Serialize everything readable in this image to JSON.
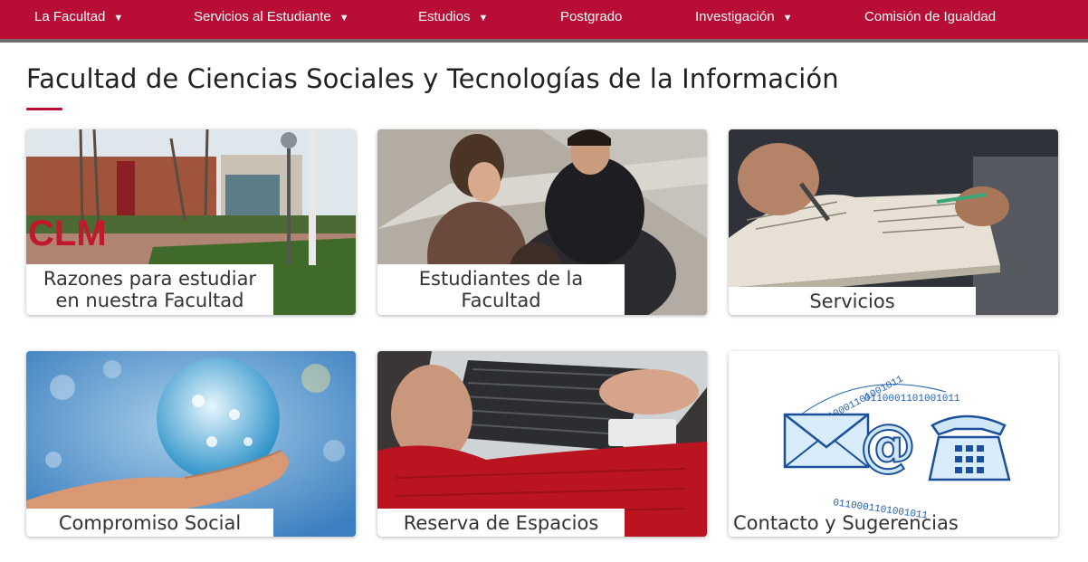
{
  "nav": {
    "items": [
      {
        "label": "La Facultad",
        "caret": "▼"
      },
      {
        "label": "Servicios al Estudiante",
        "caret": "▼"
      },
      {
        "label": "Estudios",
        "caret": "▼"
      },
      {
        "label": "Postgrado",
        "caret": ""
      },
      {
        "label": "Investigación",
        "caret": "▼"
      },
      {
        "label": "Comisión de Igualdad",
        "caret": ""
      }
    ]
  },
  "page": {
    "title": "Facultad de Ciencias Sociales y Tecnologías de la Información"
  },
  "cards": [
    {
      "line1": "Razones para estudiar",
      "line2": "en nuestra Facultad"
    },
    {
      "line1": "Estudiantes de la",
      "line2": "Facultad"
    },
    {
      "label": "Servicios"
    },
    {
      "label": "Compromiso Social"
    },
    {
      "label": "Reserva de Espacios"
    },
    {
      "label": "Contacto y Sugerencias"
    }
  ],
  "images": {
    "sign_text": "CLM",
    "binary_text": "0110001101001011",
    "at_symbol": "@"
  },
  "colors": {
    "brand": "#b80d34",
    "nav_border": "#6c6c6c",
    "title_text": "#222222"
  }
}
